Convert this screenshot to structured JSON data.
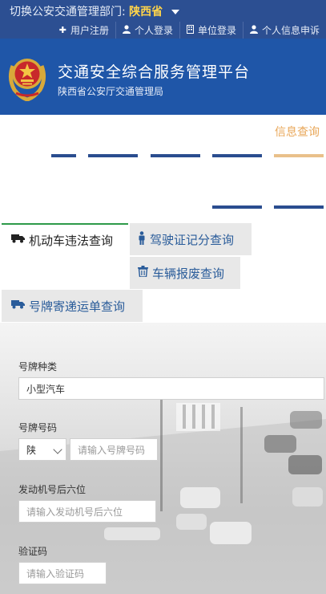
{
  "topbar": {
    "region_prefix": "切换公安交通管理部门:",
    "region_value": "陕西省",
    "links": [
      {
        "label": "用户注册",
        "icon": "plus-icon"
      },
      {
        "label": "个人登录",
        "icon": "user-icon"
      },
      {
        "label": "单位登录",
        "icon": "building-icon"
      },
      {
        "label": "个人信息申诉",
        "icon": "user-icon"
      }
    ]
  },
  "header": {
    "title": "交通安全综合服务管理平台",
    "subtitle": "陕西省公安厅交通管理局"
  },
  "nav": {
    "info_label": "信息查询"
  },
  "tabs": [
    {
      "label": "机动车违法查询",
      "icon": "truck-icon",
      "active": true
    },
    {
      "label": "驾驶证记分查询",
      "icon": "person-icon",
      "active": false
    },
    {
      "label": "车辆报废查询",
      "icon": "trash-icon",
      "active": false
    },
    {
      "label": "号牌寄递运单查询",
      "icon": "truck-icon",
      "active": false
    }
  ],
  "form": {
    "plate_type_label": "号牌种类",
    "plate_type_value": "小型汽车",
    "plate_number_label": "号牌号码",
    "plate_prefix_value": "陕",
    "plate_number_placeholder": "请输入号牌号码",
    "engine_label": "发动机号后六位",
    "engine_placeholder": "请输入发动机号后六位",
    "captcha_label": "验证码",
    "captcha_placeholder": "请输入验证码"
  },
  "colors": {
    "topbar": "#2c4f92",
    "header": "#1f56a8",
    "region_highlight": "#ffd44a",
    "active_tab_border": "#2e9a4a",
    "nav_info": "#e9a85b"
  }
}
